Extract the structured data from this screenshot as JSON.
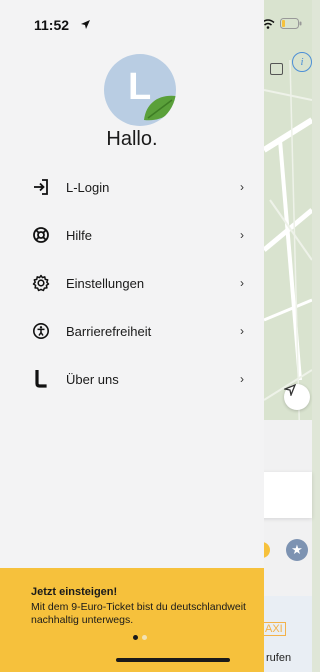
{
  "status_bar": {
    "time": "11:52"
  },
  "profile": {
    "avatar_letter": "L",
    "greeting": "Hallo."
  },
  "menu": [
    {
      "icon": "login-icon",
      "label": "L-Login"
    },
    {
      "icon": "lifebuoy-icon",
      "label": "Hilfe"
    },
    {
      "icon": "gear-icon",
      "label": "Einstellungen"
    },
    {
      "icon": "accessibility-icon",
      "label": "Barrierefreiheit"
    },
    {
      "icon": "l-logo-icon",
      "label": "Über uns"
    }
  ],
  "promo": {
    "title": "Jetzt einsteigen!",
    "body": "Mit dem 9-Euro-Ticket bist du deutschlandweit nachhaltig unterwegs.",
    "page_index": 1,
    "page_count": 2
  },
  "background": {
    "partial_label": "rufen",
    "taxi_label": "AXI"
  },
  "colors": {
    "accent_yellow": "#f6c13c",
    "avatar_blue": "#b9cde3",
    "leaf_green": "#5aa03a",
    "info_blue": "#4d8fd6"
  }
}
